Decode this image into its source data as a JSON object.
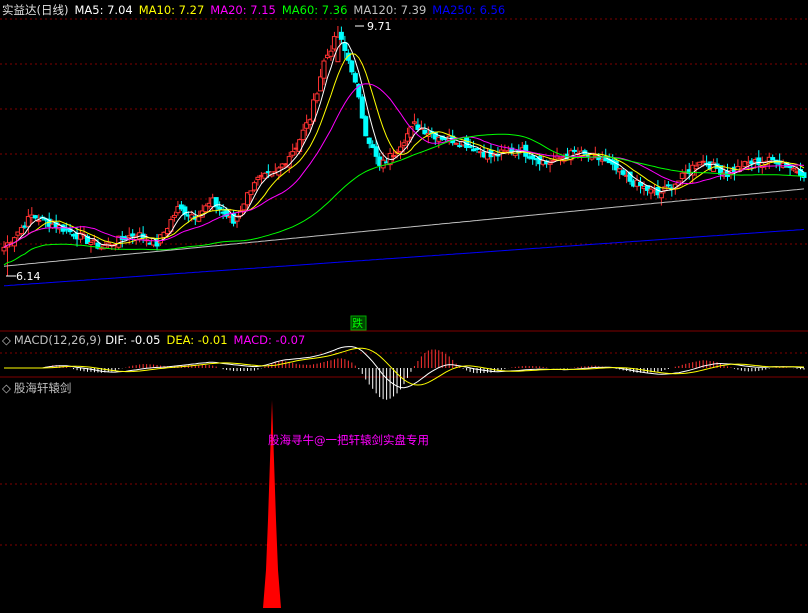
{
  "main_panel": {
    "stock_name": "实益达(日线)",
    "ma_labels": [
      {
        "text": "MA5: 7.04",
        "color": "#ffffff"
      },
      {
        "text": "MA10: 7.27",
        "color": "#ffff00"
      },
      {
        "text": "MA20: 7.15",
        "color": "#ff00ff"
      },
      {
        "text": "MA60: 7.36",
        "color": "#00ff00"
      },
      {
        "text": "MA120: 7.39",
        "color": "#c0c0c0"
      },
      {
        "text": "MA250: 6.56",
        "color": "#0000ff"
      }
    ],
    "high_label": "9.71",
    "low_label": "6.14",
    "signal_label": "跌"
  },
  "macd_panel": {
    "title": "MACD(12,26,9)",
    "dif": "DIF: -0.05",
    "dea": "DEA: -0.01",
    "macd": "MACD: -0.07"
  },
  "indicator_panel": {
    "title": "股海轩辕剑",
    "watermark": "股海寻牛@一把轩辕剑实盘专用"
  },
  "chart_data": {
    "type": "candlestick",
    "price_range": [
      6.14,
      9.71
    ],
    "high": 9.71,
    "low": 6.14,
    "latest_ma": {
      "MA5": 7.04,
      "MA10": 7.27,
      "MA20": 7.15,
      "MA60": 7.36,
      "MA120": 7.39,
      "MA250": 6.56
    },
    "macd": {
      "DIF": -0.05,
      "DEA": -0.01,
      "MACD": -0.07
    },
    "colors": {
      "up": "#ff3232",
      "down": "#00ffff",
      "grid": "#800000",
      "spike": "#ff0000"
    }
  }
}
